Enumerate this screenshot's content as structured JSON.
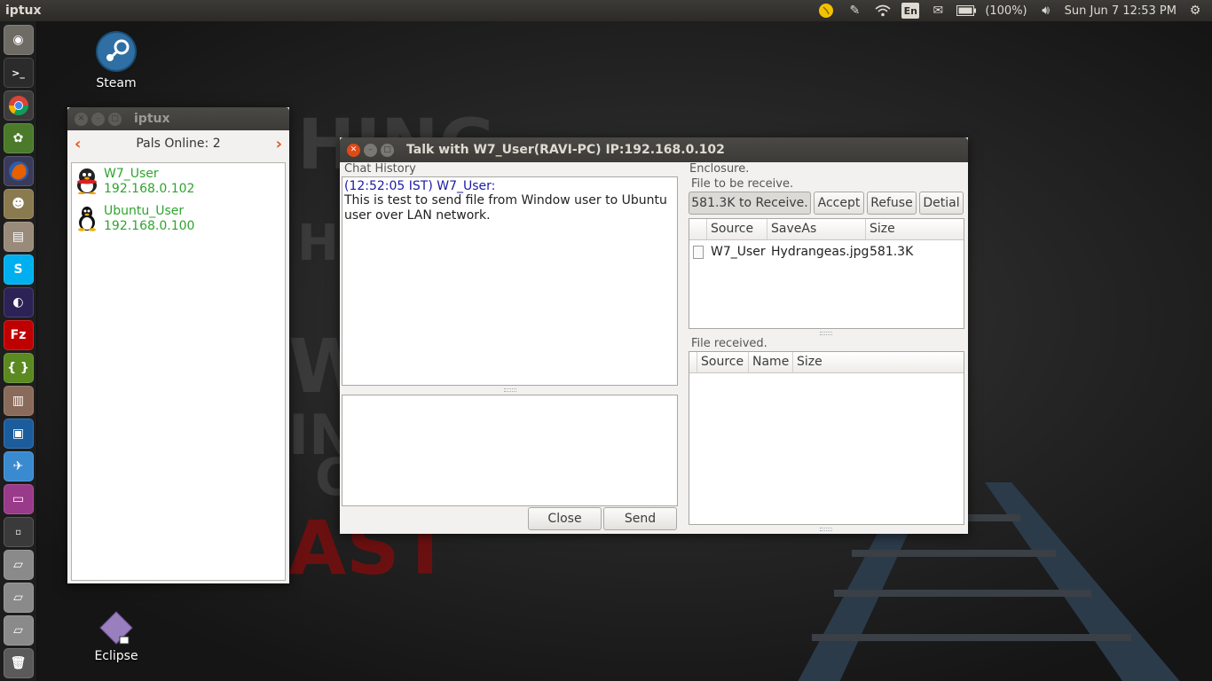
{
  "top_panel": {
    "app_title": "iptux",
    "keyboard": "En",
    "battery": "(100%)",
    "clock": "Sun Jun 7 12:53 PM"
  },
  "desktop": {
    "steam_label": "Steam",
    "eclipse_label": "Eclipse",
    "wallpaper_words": [
      "HING",
      "HIS",
      "WO",
      "IN",
      "O",
      "AST"
    ]
  },
  "launcher": {
    "items": [
      "ubuntu",
      "terminal",
      "chrome",
      "leafpad",
      "firefox",
      "gimp",
      "files",
      "skype",
      "eclipse",
      "filezilla",
      "brackets",
      "mixer",
      "virtualbox",
      "iptux",
      "workspaces",
      "screen",
      "drive1",
      "drive2",
      "drive3",
      "trash"
    ]
  },
  "pals_window": {
    "title": "iptux",
    "online_label": "Pals Online: 2",
    "pals": [
      {
        "name": "W7_User",
        "ip": "192.168.0.102"
      },
      {
        "name": "Ubuntu_User",
        "ip": "192.168.0.100"
      }
    ]
  },
  "talk_window": {
    "title": "Talk with W7_User(RAVI-PC) IP:192.168.0.102",
    "chat_history_label": "Chat History",
    "message_header": "(12:52:05 IST) W7_User:",
    "message_body": "This is test to send file from Window user to Ubuntu user over LAN network.",
    "input_value": "",
    "close_label": "Close",
    "send_label": "Send",
    "enclosure_label": "Enclosure.",
    "to_receive_label": "File to be receive.",
    "receive_button": "581.3K to Receive.",
    "accept_button": "Accept",
    "refuse_button": "Refuse",
    "detail_button": "Detial",
    "pending_columns": [
      "Source",
      "SaveAs",
      "Size"
    ],
    "pending_files": [
      {
        "source": "W7_User",
        "saveas": "Hydrangeas.jpg",
        "size": "581.3K"
      }
    ],
    "received_label": "File received.",
    "received_columns": [
      "Source",
      "Name",
      "Size"
    ]
  }
}
